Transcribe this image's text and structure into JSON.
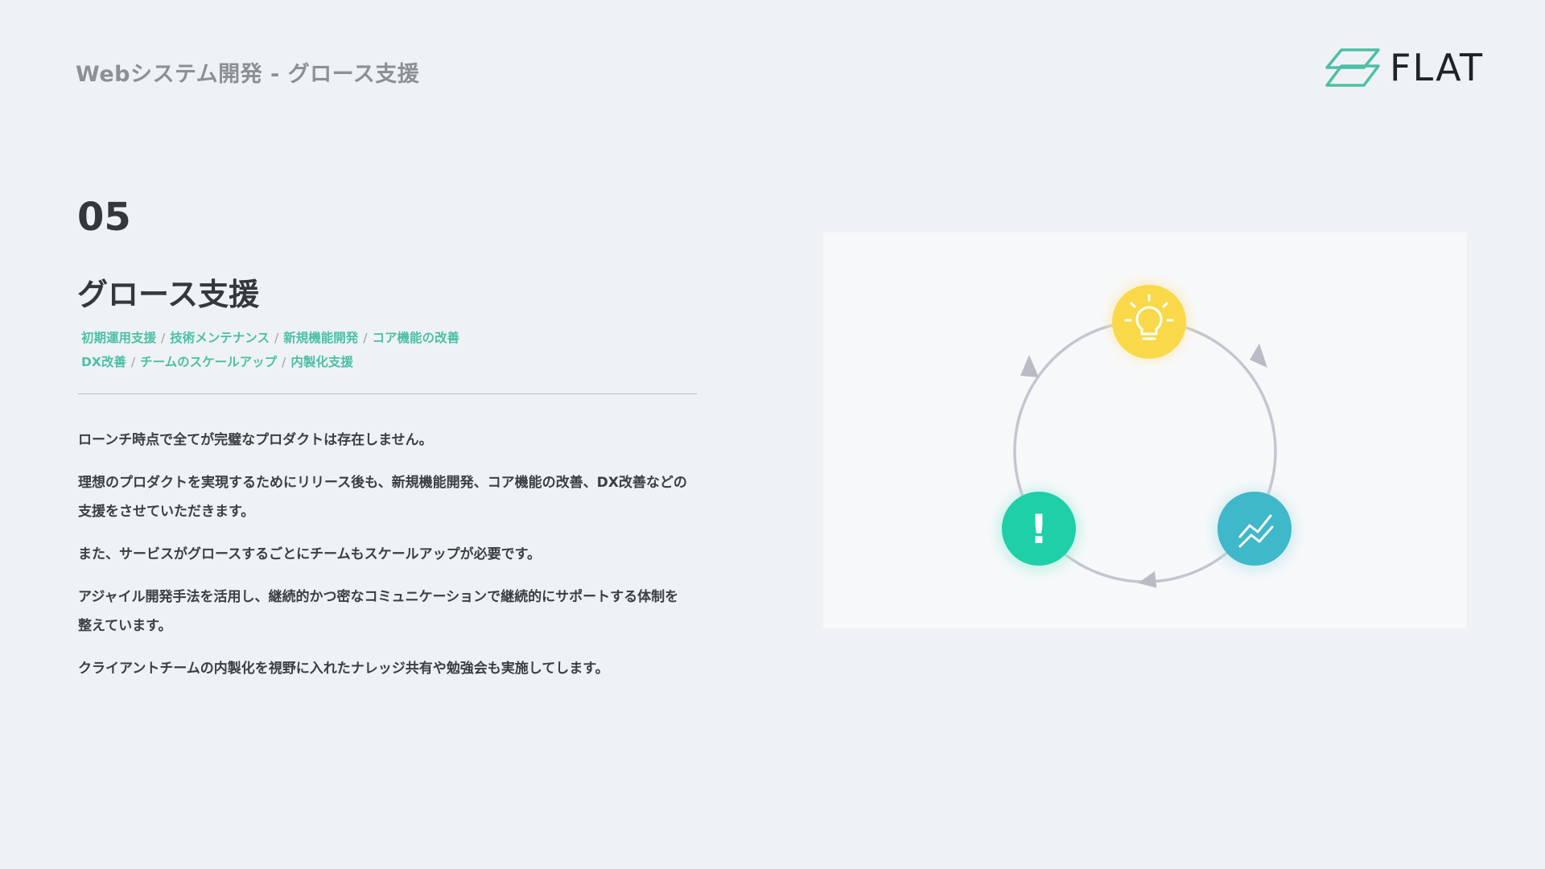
{
  "header": {
    "title": "Webシステム開発 - グロース支援"
  },
  "logo": {
    "text": "FLAT",
    "icon": "flat-logo-icon",
    "color": "#4cbfa6"
  },
  "section": {
    "number": "05",
    "title": "グロース支援",
    "tags": [
      "初期運用支援",
      "技術メンテナンス",
      "新規機能開発",
      "コア機能の改善",
      "DX改善",
      "チームのスケールアップ",
      "内製化支援"
    ],
    "paragraphs": [
      "ローンチ時点で全てが完璧なプロダクトは存在しません。",
      "理想のプロダクトを実現するためにリリース後も、新規機能開発、コア機能の改善、DX改善などの支援をさせていただきます。",
      "また、サービスがグロースするごとにチームもスケールアップが必要です。",
      "アジャイル開発手法を活用し、継続的かつ密なコミュニケーションで継続的にサポートする体制を整えています。",
      "クライアントチームの内製化を視野に入れたナレッジ共有や勉強会も実施してします。"
    ]
  },
  "illustration": {
    "nodes": [
      {
        "icon": "lightbulb-icon",
        "color": "#f9d94a"
      },
      {
        "icon": "chart-trend-icon",
        "color": "#3fb8c9"
      },
      {
        "icon": "exclamation-icon",
        "color": "#1ecfa8"
      }
    ],
    "cycle_color": "#c3c6cf",
    "exclamation": "!"
  }
}
